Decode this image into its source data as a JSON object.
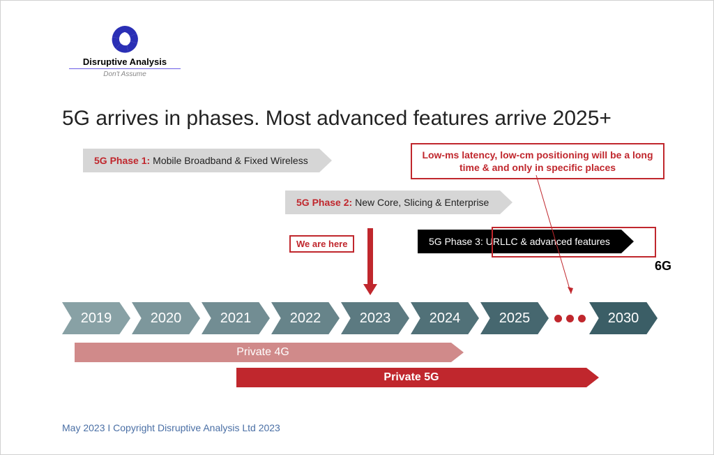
{
  "brand": {
    "name": "Disruptive Analysis",
    "tagline": "Don't Assume"
  },
  "title": "5G arrives in phases. Most advanced features arrive 2025+",
  "phases": {
    "p1": {
      "label": "5G Phase 1:",
      "text": "Mobile Broadband & Fixed Wireless"
    },
    "p2": {
      "label": "5G Phase 2:",
      "text": "New Core, Slicing & Enterprise"
    },
    "p3": {
      "label": "5G Phase 3:",
      "text": "URLLC & advanced features"
    }
  },
  "callout": "Low-ms latency, low-cm positioning will be a long time & and only in specific places",
  "we_are_here": "We are here",
  "sixg": "6G",
  "years": [
    "2019",
    "2020",
    "2021",
    "2022",
    "2023",
    "2024",
    "2025"
  ],
  "year_end": "2030",
  "private4g": "Private 4G",
  "private5g": "Private 5G",
  "footer": "May 2023  I  Copyright Disruptive Analysis Ltd 2023"
}
